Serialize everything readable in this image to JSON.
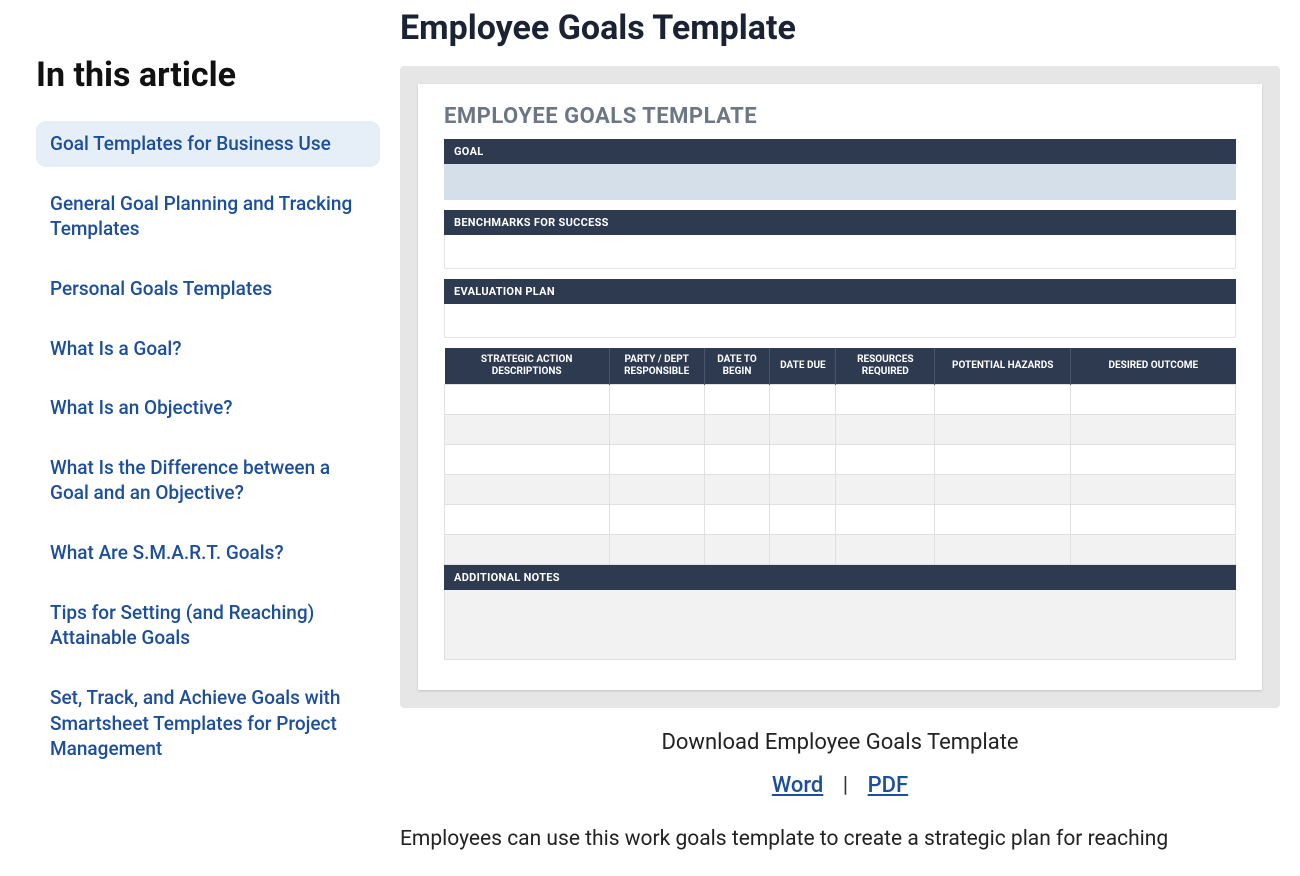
{
  "sidebar": {
    "heading": "In this article",
    "items": [
      "Goal Templates for Business Use",
      "General Goal Planning and Tracking Templates",
      "Personal Goals Templates",
      "What Is a Goal?",
      "What Is an Objective?",
      "What Is the Difference between a Goal and an Objective?",
      "What Are S.M.A.R.T. Goals?",
      "Tips for Setting (and Reaching) Attainable Goals",
      "Set, Track, and Achieve Goals with Smartsheet Templates for Project Management"
    ],
    "active_index": 0
  },
  "main": {
    "heading": "Employee Goals Template",
    "template": {
      "title": "EMPLOYEE GOALS TEMPLATE",
      "sections": {
        "goal": "GOAL",
        "benchmarks": "BENCHMARKS FOR SUCCESS",
        "evaluation": "EVALUATION PLAN",
        "notes": "ADDITIONAL NOTES"
      },
      "columns": [
        "STRATEGIC ACTION DESCRIPTIONS",
        "PARTY / DEPT RESPONSIBLE",
        "DATE TO BEGIN",
        "DATE DUE",
        "RESOURCES REQUIRED",
        "POTENTIAL HAZARDS",
        "DESIRED OUTCOME"
      ],
      "row_count": 6
    },
    "download": {
      "caption": "Download Employee Goals Template",
      "word": "Word",
      "sep": "|",
      "pdf": "PDF"
    },
    "body": "Employees can use this work goals template to create a strategic plan for reaching"
  }
}
